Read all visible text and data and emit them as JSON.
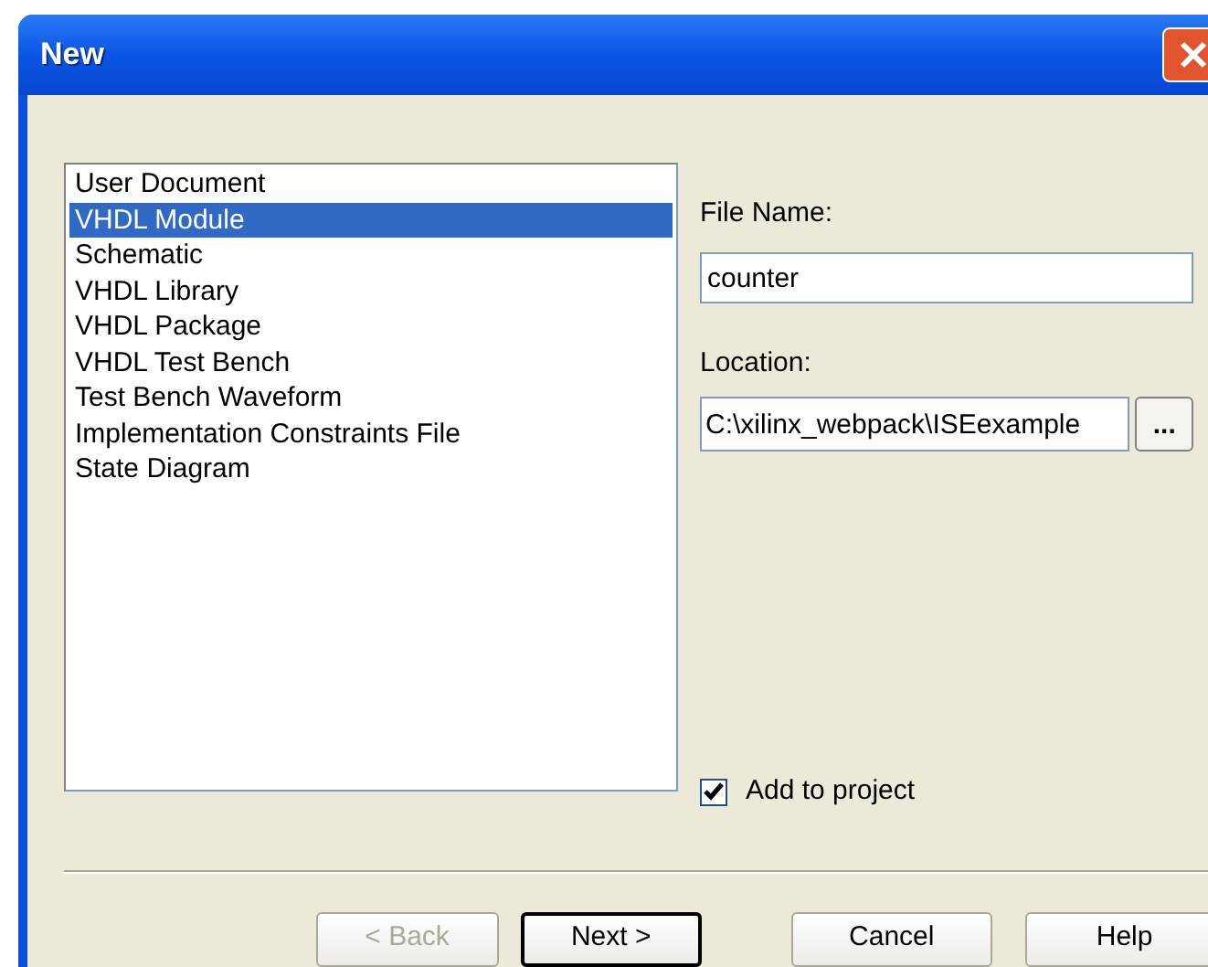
{
  "window": {
    "title": "New"
  },
  "file_types": [
    {
      "label": "User Document",
      "selected": false
    },
    {
      "label": "VHDL Module",
      "selected": true
    },
    {
      "label": "Schematic",
      "selected": false
    },
    {
      "label": "VHDL Library",
      "selected": false
    },
    {
      "label": "VHDL Package",
      "selected": false
    },
    {
      "label": "VHDL Test Bench",
      "selected": false
    },
    {
      "label": "Test Bench Waveform",
      "selected": false
    },
    {
      "label": "Implementation Constraints File",
      "selected": false
    },
    {
      "label": "State Diagram",
      "selected": false
    }
  ],
  "file_name": {
    "label": "File Name:",
    "value": "counter"
  },
  "location": {
    "label": "Location:",
    "value": "C:\\xilinx_webpack\\ISEexample",
    "browse": "..."
  },
  "add_to_project": {
    "label": "Add to project",
    "checked": true
  },
  "buttons": [
    {
      "label": "< Back",
      "disabled": true,
      "default": false
    },
    {
      "label": "Next >",
      "disabled": false,
      "default": true
    },
    {
      "label": "Cancel",
      "disabled": false,
      "default": false
    },
    {
      "label": "Help",
      "disabled": false,
      "default": false
    }
  ]
}
